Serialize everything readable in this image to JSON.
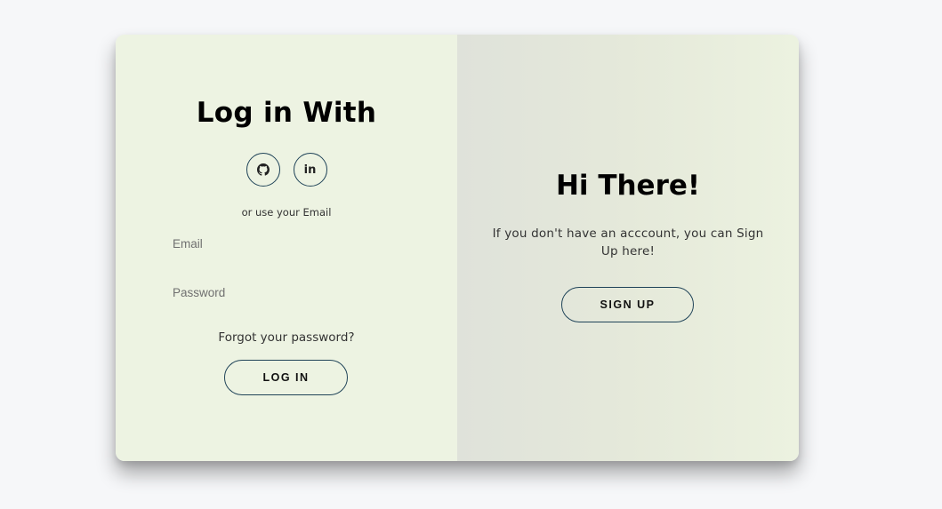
{
  "login": {
    "title": "Log in With",
    "social": [
      {
        "name": "github",
        "icon": "github-icon"
      },
      {
        "name": "linkedin",
        "icon": "linkedin-icon",
        "glyph": "in"
      }
    ],
    "alt_text": "or use your Email",
    "email": {
      "value": "",
      "placeholder": "Email"
    },
    "password": {
      "value": "",
      "placeholder": "Password"
    },
    "forgot_label": "Forgot your password?",
    "button_label": "LOG IN"
  },
  "signup": {
    "title": "Hi There!",
    "text": "If you don't have an acccount, you can Sign Up here!",
    "button_label": "SIGN UP"
  },
  "colors": {
    "page_background": "#f6f7f9",
    "left_panel": "#edf3e2",
    "right_panel_start": "#dfe2da",
    "right_panel_end": "#ecf2e0",
    "button_border": "#1f4358"
  }
}
